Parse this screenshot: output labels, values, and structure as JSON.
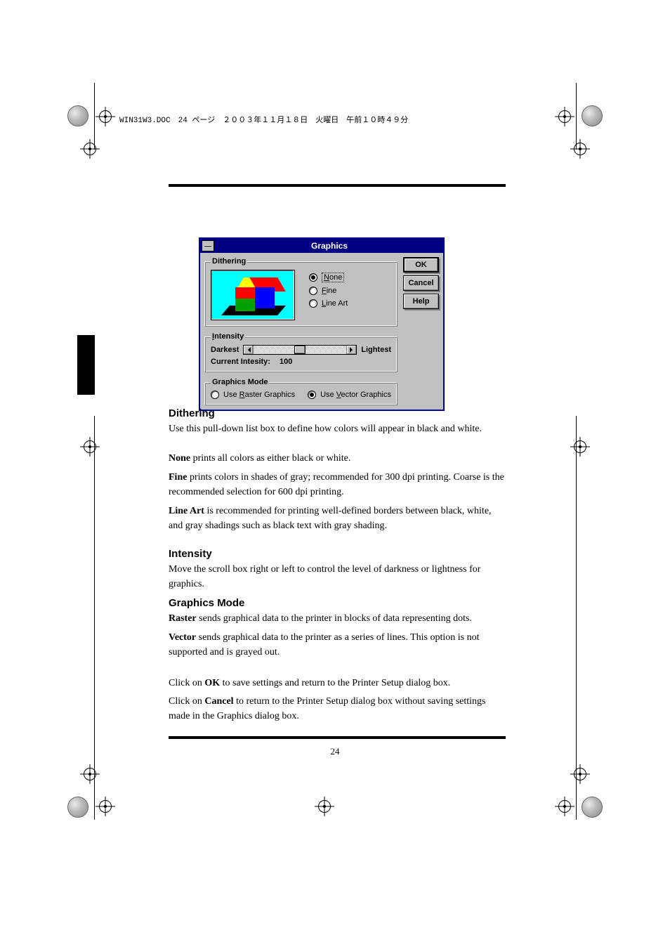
{
  "header_line": "WIN31W3.DOC　24 ページ　２００３年１１月１８日　火曜日　午前１０時４９分",
  "dialog": {
    "title": "Graphics",
    "groups": {
      "dithering": {
        "legend": "Dithering",
        "options": {
          "none": "None",
          "fine": "Fine",
          "lineart": "Line Art"
        },
        "selected": "none"
      },
      "intensity": {
        "legend": "Intensity",
        "darkest": "Darkest",
        "lightest": "Lightest",
        "current_label": "Current Intesity:",
        "current_value": "100"
      },
      "graphics_mode": {
        "legend": "Graphics Mode",
        "raster": "Use Raster Graphics",
        "vector": "Use Vector Graphics",
        "selected": "vector"
      }
    },
    "buttons": {
      "ok": "OK",
      "cancel": "Cancel",
      "help": "Help"
    }
  },
  "sections": {
    "dithering_head": "Dithering",
    "dithering_body": "Use this pull-down list box to define how colors will appear in black and white.",
    "dither_none": "None prints all colors as either black or white.",
    "dither_fine": "Fine prints colors in shades of gray; recommended for 300 dpi printing. Coarse is the recommended selection for 600 dpi printing.",
    "dither_lineart": "Line Art is recommended for printing well-defined borders between black, white, and gray shadings such as black text with gray shading.",
    "intensity_head": "Intensity",
    "intensity_body": "Move the scroll box right or left to control the level of darkness or lightness for graphics.",
    "graphics_mode_head": "Graphics Mode",
    "raster_line": "Raster sends graphical data to the printer in blocks of data representing dots.",
    "vector_line": "Vector sends graphical data to the printer as a series of lines. This option is not supported and is grayed out.",
    "ok_line": "Click on OK to save settings and return to the Printer Setup dialog box.",
    "cancel_line": "Click on Cancel to return to the Printer Setup dialog box without saving settings made in the Graphics dialog box."
  },
  "terms": {
    "none": "None",
    "fine": "Fine",
    "lineart": "Line Art",
    "raster": "Raster",
    "vector": "Vector",
    "ok": "OK",
    "cancel": "Cancel"
  },
  "page_number": "24"
}
